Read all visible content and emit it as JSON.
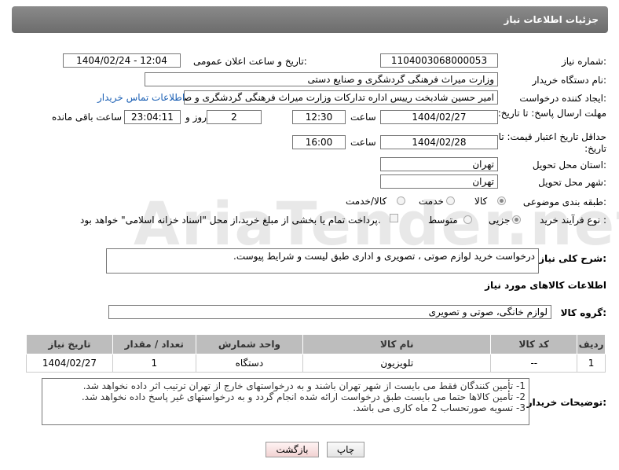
{
  "header": {
    "title": "جزئیات اطلاعات نیاز"
  },
  "watermark": "AriaTender.net",
  "form": {
    "need_number_label": "شماره نیاز:",
    "need_number": "1104003068000053",
    "announce_label": "تاریخ و ساعت اعلان عمومی:",
    "announce_value": "1404/02/24 - 12:04",
    "buyer_label": "نام دستگاه خریدار:",
    "buyer_value": "وزارت میراث فرهنگی  گردشگری و صنایع دستی",
    "creator_label": "ایجاد کننده درخواست:",
    "creator_value": "امیر حسین شادبخت رییس اداره تدارکات وزارت میراث فرهنگی  گردشگری و صنایع دستی",
    "contact_link": "اطلاعات تماس خریدار",
    "reply_deadline_label": "مهلت ارسال پاسخ: تا تاریخ:",
    "reply_date": "1404/02/27",
    "time_label": "ساعت",
    "reply_time": "12:30",
    "days_value": "2",
    "days_label": "روز و",
    "remaining_value": "23:04:11",
    "remaining_label": "ساعت باقی مانده",
    "price_deadline_label": "حداقل تاریخ اعتبار قیمت: تا تاریخ:",
    "price_date": "1404/02/28",
    "price_time": "16:00",
    "province_label": "استان محل تحویل:",
    "province_value": "تهران",
    "city_label": "شهر محل تحویل:",
    "city_value": "تهران",
    "category_label": "طبقه بندی موضوعی:",
    "category_options": [
      "کالا",
      "خدمت",
      "کالا/خدمت"
    ],
    "process_label": "نوع فرآیند خرید :",
    "process_options": [
      "جزیی",
      "متوسط"
    ],
    "payment_text": "پرداخت تمام یا بخشی از مبلغ خرید،از محل \"اسناد خزانه اسلامی\" خواهد بود.",
    "description_label": "شرح کلی نیاز:",
    "description_value": "درخواست خرید لوازم صوتی ، تصویری و اداری طبق لیست و  شرایط پیوست."
  },
  "goods": {
    "section_title": "اطلاعات کالاهای مورد نیاز",
    "group_label": "گروه کالا:",
    "group_value": "لوازم خانگی، صوتی و تصویری",
    "columns": [
      "ردیف",
      "کد کالا",
      "نام کالا",
      "واحد شمارش",
      "تعداد / مقدار",
      "تاریخ نیاز"
    ],
    "rows": [
      [
        "1",
        "--",
        "تلویزیون",
        "دستگاه",
        "1",
        "1404/02/27"
      ]
    ]
  },
  "notes": {
    "label": "توضیحات خریدار:",
    "lines": [
      "1- تأمین کنندگان فقط می بایست از شهر تهران باشند و به درخواستهای خارج از تهران ترتیب اثر داده نخواهد شد.",
      "2- تأمین کالاها حتما می بایست طبق درخواست ارائه شده انجام گردد و به درخواستهای غیر پاسخ داده نخواهد شد.",
      "3- تسویه صورتحساب 2 ماه کاری می باشد."
    ]
  },
  "buttons": {
    "print": "چاپ",
    "back": "بازگشت"
  }
}
